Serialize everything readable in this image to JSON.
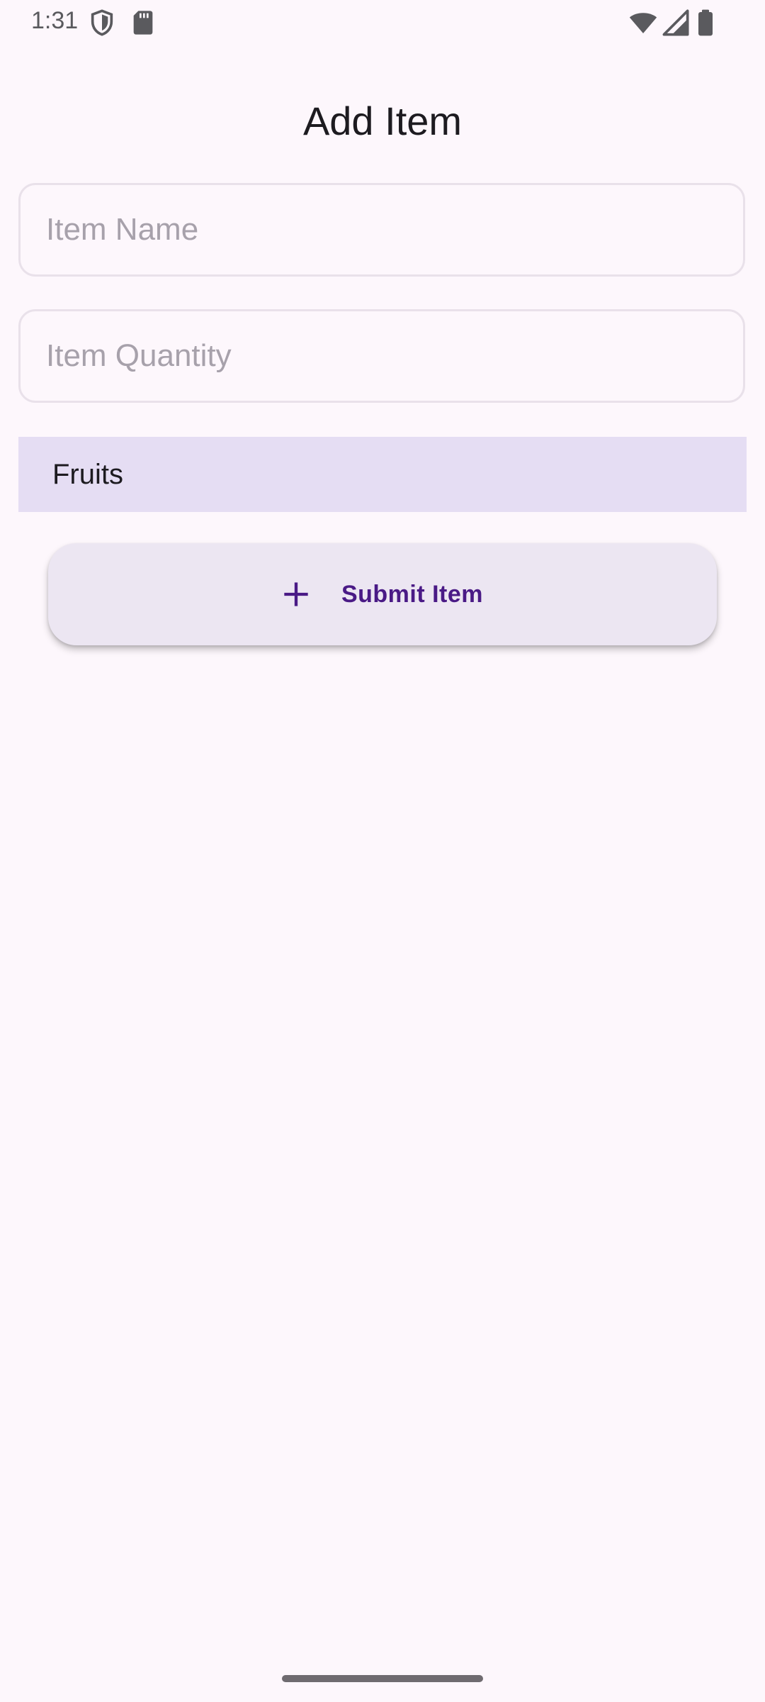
{
  "status_bar": {
    "time": "1:31",
    "left_icons": [
      "shield-icon",
      "sd-card-icon"
    ],
    "right_icons": [
      "wifi-icon",
      "cellular-signal-icon",
      "battery-icon"
    ]
  },
  "header": {
    "title": "Add Item"
  },
  "form": {
    "item_name": {
      "value": "",
      "placeholder": "Item Name"
    },
    "item_quantity": {
      "value": "",
      "placeholder": "Item Quantity"
    },
    "category": {
      "selected": "Fruits"
    },
    "submit": {
      "label": "Submit Item",
      "icon": "plus-icon"
    }
  },
  "colors": {
    "background": "#FDF7FC",
    "category_background": "#E5DDF3",
    "button_background": "#ECE6F2",
    "button_text": "#4A1A86"
  }
}
